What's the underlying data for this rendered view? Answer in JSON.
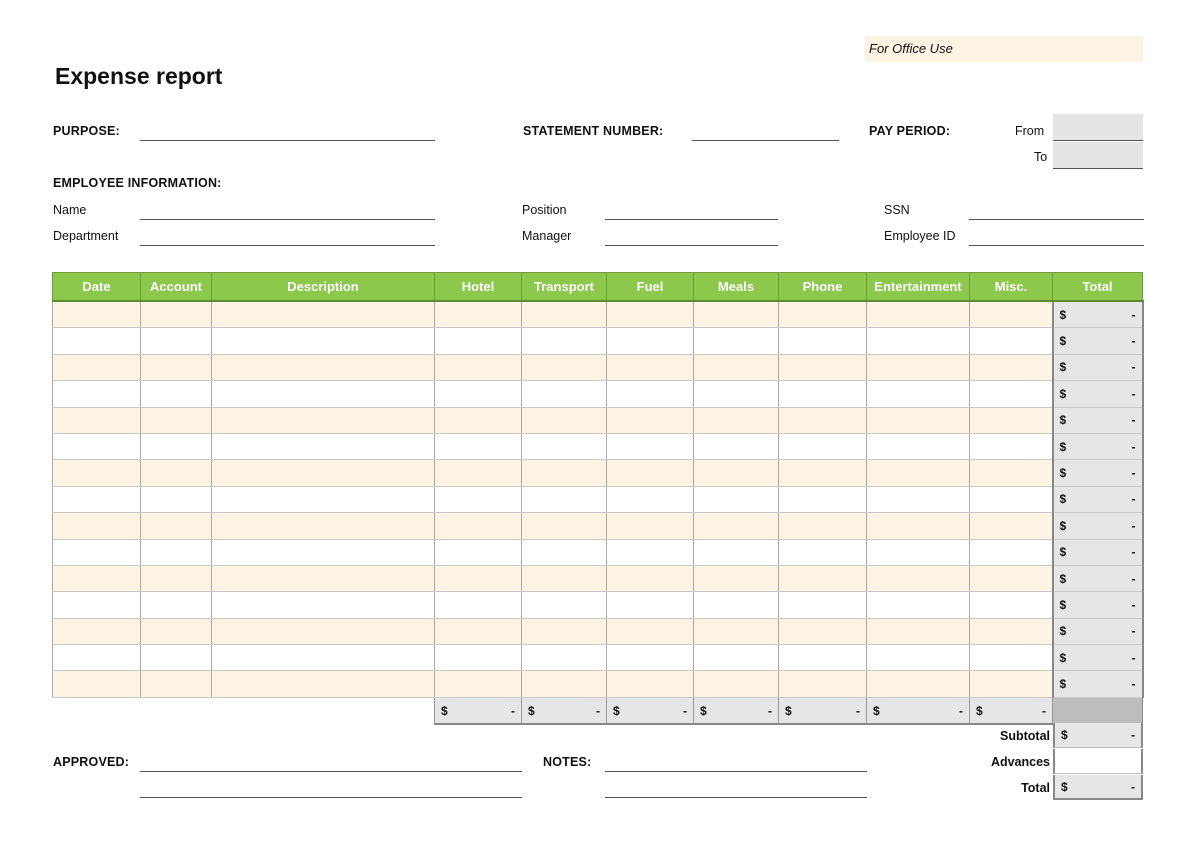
{
  "office_use": "For Office Use",
  "title": "Expense report",
  "header": {
    "purpose_label": "PURPOSE:",
    "purpose_value": "",
    "statement_label": "STATEMENT NUMBER:",
    "statement_value": "",
    "pay_period_label": "PAY PERIOD:",
    "from_label": "From",
    "from_value": "",
    "to_label": "To",
    "to_value": ""
  },
  "employee": {
    "section_label": "EMPLOYEE INFORMATION:",
    "name_label": "Name",
    "department_label": "Department",
    "position_label": "Position",
    "manager_label": "Manager",
    "ssn_label": "SSN",
    "employee_id_label": "Employee ID"
  },
  "table": {
    "columns": [
      "Date",
      "Account",
      "Description",
      "Hotel",
      "Transport",
      "Fuel",
      "Meals",
      "Phone",
      "Entertainment",
      "Misc.",
      "Total"
    ],
    "row_count": 15,
    "currency_symbol": "$",
    "empty_amount": "-",
    "rows": [
      {
        "total": "-"
      },
      {
        "total": "-"
      },
      {
        "total": "-"
      },
      {
        "total": "-"
      },
      {
        "total": "-"
      },
      {
        "total": "-"
      },
      {
        "total": "-"
      },
      {
        "total": "-"
      },
      {
        "total": "-"
      },
      {
        "total": "-"
      },
      {
        "total": "-"
      },
      {
        "total": "-"
      },
      {
        "total": "-"
      },
      {
        "total": "-"
      },
      {
        "total": "-"
      }
    ],
    "column_sums": {
      "hotel": "-",
      "transport": "-",
      "fuel": "-",
      "meals": "-",
      "phone": "-",
      "entertainment": "-",
      "misc": "-"
    }
  },
  "summary": {
    "subtotal_label": "Subtotal",
    "subtotal_value": "-",
    "advances_label": "Advances",
    "advances_value": "",
    "total_label": "Total",
    "total_value": "-"
  },
  "footer": {
    "approved_label": "APPROVED:",
    "notes_label": "NOTES:"
  },
  "colors": {
    "header_green": "#8cc84b",
    "row_tint": "#fdf3e3",
    "total_grey": "#e6e6e6"
  }
}
